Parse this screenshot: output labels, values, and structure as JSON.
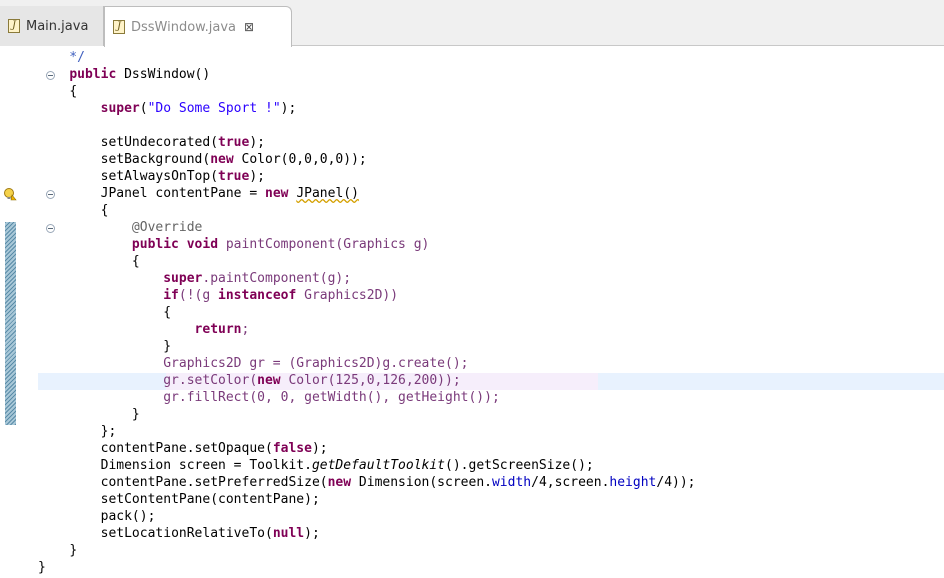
{
  "tabs": [
    {
      "label": "Main.java",
      "active": false
    },
    {
      "label": "DssWindow.java",
      "active": true,
      "close": "⊠"
    }
  ],
  "code": {
    "l0": "    */",
    "l1_kw": "public",
    "l1_rest": " DssWindow()",
    "l2": "{",
    "l3_kw": "super",
    "l3_str": "\"Do Some Sport !\"",
    "l5_a": "setUndecorated(",
    "l5_kw": "true",
    "l5_b": ");",
    "l6_a": "setBackground(",
    "l6_kw": "new",
    "l6_b": " Color(0,0,0,0));",
    "l7_a": "setAlwaysOnTop(",
    "l7_kw": "true",
    "l7_b": ");",
    "l8_a": "JPanel contentPane = ",
    "l8_kw": "new",
    "l8_b": " ",
    "l8_sq": "JPanel()",
    "l9": "{",
    "l10": "@Override",
    "l11_kw1": "public",
    "l11_kw2": "void",
    "l11_rest": " paintComponent(Graphics g)",
    "l12": "{",
    "l13_kw": "super",
    "l13_rest": ".paintComponent(g);",
    "l14_kw1": "if",
    "l14_a": "(!(g ",
    "l14_kw2": "instanceof",
    "l14_b": " Graphics2D))",
    "l15": "{",
    "l16_kw": "return",
    "l16_b": ";",
    "l17": "}",
    "l18": "Graphics2D gr = (Graphics2D)g.create();",
    "l19_a": "gr.setColor(",
    "l19_kw": "new",
    "l19_b": " Color(125,0,126,200));",
    "l20": "gr.fillRect(0, 0, getWidth(), getHeight());",
    "l21": "}",
    "l22": "};",
    "l23_a": "contentPane.setOpaque(",
    "l23_kw": "false",
    "l23_b": ");",
    "l24_a": "Dimension screen = Toolkit.",
    "l24_i": "getDefaultToolkit",
    "l24_b": "().getScreenSize();",
    "l25_a": "contentPane.setPreferredSize(",
    "l25_kw": "new",
    "l25_b": " Dimension(screen.",
    "l25_f1": "width",
    "l25_c": "/4,screen.",
    "l25_f2": "height",
    "l25_d": "/4));",
    "l26": "setContentPane(contentPane);",
    "l27": "pack();",
    "l28_a": "setLocationRelativeTo(",
    "l28_kw": "null",
    "l28_b": ");",
    "l29": "}",
    "l30": "}"
  },
  "icons": {
    "warning": "warning-bulb-icon",
    "fold": "fold-collapse-icon",
    "java_file": "java-file-icon"
  }
}
